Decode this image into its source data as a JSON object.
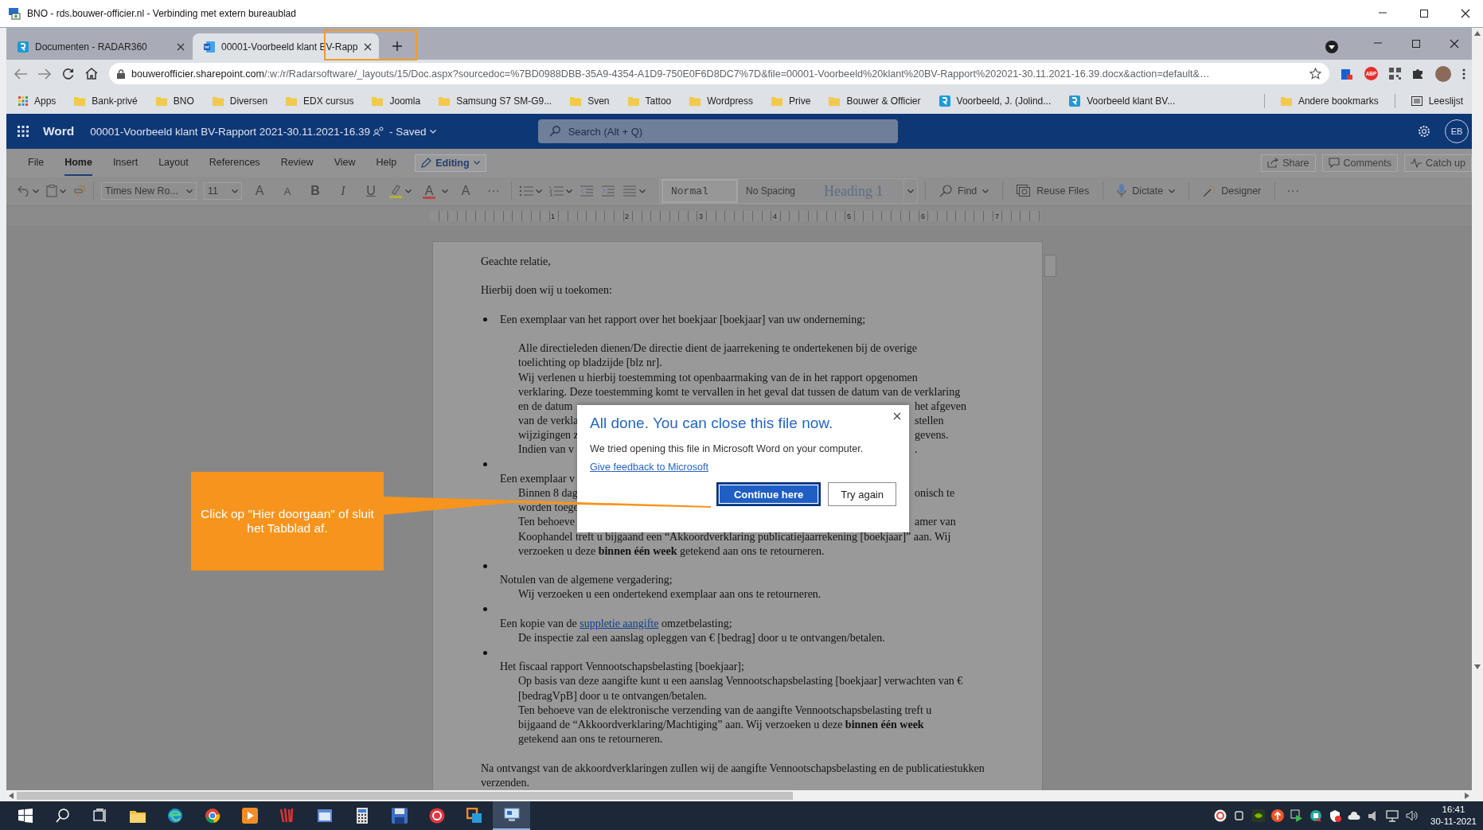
{
  "remote_window": {
    "title": "BNO - rds.bouwer-officier.nl - Verbinding met extern bureaublad"
  },
  "browser": {
    "tabs": [
      {
        "title": "Documenten - RADAR360",
        "kind": "site",
        "selected": false
      },
      {
        "title": "00001-Voorbeeld klant BV-Rapp",
        "kind": "document",
        "selected": true
      }
    ],
    "address": {
      "host": "bouwerofficier.sharepoint.com",
      "path": "/:w:/r/Radarsoftware/_layouts/15/Doc.aspx?sourcedoc=%7BD0988DBB-35A9-4354-A1D9-750E0F6D8DC7%7D&file=00001-Voorbeeld%20klant%20BV-Rapport%202021-30.11.2021-16.39.docx&action=default&…"
    },
    "extension_badge": "ABP",
    "bookmarks": [
      {
        "label": "Apps",
        "kind": "apps"
      },
      {
        "label": "Bank-privé",
        "kind": "folder"
      },
      {
        "label": "BNO",
        "kind": "folder"
      },
      {
        "label": "Diversen",
        "kind": "folder"
      },
      {
        "label": "EDX cursus",
        "kind": "folder"
      },
      {
        "label": "Joomla",
        "kind": "folder"
      },
      {
        "label": "Samsung S7 SM-G9...",
        "kind": "folder"
      },
      {
        "label": "Sven",
        "kind": "folder"
      },
      {
        "label": "Tattoo",
        "kind": "folder"
      },
      {
        "label": "Wordpress",
        "kind": "folder"
      },
      {
        "label": "Prive",
        "kind": "folder"
      },
      {
        "label": "Bouwer & Officier",
        "kind": "folder"
      },
      {
        "label": "Voorbeeld, J. (Jolind...",
        "kind": "site"
      },
      {
        "label": "Voorbeeld klant BV...",
        "kind": "site"
      }
    ],
    "bookmarks_right": [
      {
        "label": "Andere bookmarks",
        "kind": "folder"
      },
      {
        "label": "Leeslijst",
        "kind": "list"
      }
    ]
  },
  "word": {
    "app_name": "Word",
    "document_title": "00001-Voorbeeld klant BV-Rapport 2021-30.11.2021-16.39",
    "save_status": "- Saved",
    "search": {
      "placeholder": "Search (Alt + Q)"
    },
    "user_initials": "EB",
    "ribbon_tabs": [
      {
        "label": "File",
        "selected": false
      },
      {
        "label": "Home",
        "selected": true
      },
      {
        "label": "Insert",
        "selected": false
      },
      {
        "label": "Layout",
        "selected": false
      },
      {
        "label": "References",
        "selected": false
      },
      {
        "label": "Review",
        "selected": false
      },
      {
        "label": "View",
        "selected": false
      },
      {
        "label": "Help",
        "selected": false
      }
    ],
    "mode": "Editing",
    "actions": [
      {
        "kind": "share",
        "label": "Share"
      },
      {
        "kind": "comments",
        "label": "Comments"
      },
      {
        "kind": "catchup",
        "label": "Catch up"
      }
    ],
    "font_name": "Times New Ro...",
    "font_size": "11",
    "format": [
      {
        "kind": "grow",
        "text": "A"
      },
      {
        "kind": "shrink",
        "text": "A"
      },
      {
        "kind": "bold",
        "text": "B"
      },
      {
        "kind": "italic",
        "text": "I"
      },
      {
        "kind": "underline",
        "text": "U"
      },
      {
        "kind": "highlight"
      },
      {
        "kind": "fontcolor",
        "text": "A"
      },
      {
        "kind": "clear",
        "text": "A"
      },
      {
        "kind": "more",
        "text": "···"
      }
    ],
    "styles": [
      {
        "label": "Normal",
        "kind": "normal",
        "selected": true
      },
      {
        "label": "No Spacing",
        "kind": "nospacing",
        "selected": false
      },
      {
        "label": "Heading 1",
        "kind": "heading",
        "selected": false
      }
    ],
    "tools": [
      {
        "kind": "find",
        "label": "Find",
        "dropdown": true
      },
      {
        "kind": "reuse",
        "label": "Reuse Files",
        "dropdown": false
      },
      {
        "kind": "dictate",
        "label": "Dictate",
        "dropdown": true
      },
      {
        "kind": "designer",
        "label": "Designer",
        "dropdown": false
      }
    ],
    "more": "···",
    "ruler": [
      "1",
      "2",
      "3",
      "4",
      "5",
      "6",
      "7"
    ]
  },
  "document": {
    "lines": [
      {
        "kind": "para",
        "text": "Geachte relatie,"
      },
      {
        "kind": "gap"
      },
      {
        "kind": "para",
        "text": "Hierbij doen wij u toekomen:"
      },
      {
        "kind": "gap"
      },
      {
        "kind": "bullet",
        "text": "Een exemplaar van het rapport over het boekjaar [boekjaar] van uw onderneming;"
      },
      {
        "kind": "gap"
      },
      {
        "kind": "sub",
        "text": "Alle directieleden dienen/De directie dient de jaarrekening te ondertekenen bij de overige"
      },
      {
        "kind": "sub",
        "text": "toelichting op bladzijde [blz nr]."
      },
      {
        "kind": "sub",
        "text": "Wij verlenen u hierbij toestemming tot openbaarmaking van de in het rapport opgenomen"
      },
      {
        "kind": "sub",
        "text": "verklaring. Deze toestemming komt te vervallen in het geval dat tussen de datum van de verklaring"
      },
      {
        "kind": "split",
        "left": "en de datum",
        "right": "het afgeven"
      },
      {
        "kind": "split",
        "left": "van de verkla",
        "right": "stellen"
      },
      {
        "kind": "split",
        "left": "wijzigingen z",
        "right": "gevens."
      },
      {
        "kind": "split",
        "left": "Indien van v",
        "right": "."
      },
      {
        "kind": "dot"
      },
      {
        "kind": "item",
        "text": "Een exemplaar v"
      },
      {
        "kind": "split",
        "left": "Binnen 8 dag",
        "right": "onisch te"
      },
      {
        "kind": "sub",
        "text": "worden toege"
      },
      {
        "kind": "split",
        "left": "Ten behoeve",
        "right": "amer van"
      },
      {
        "kind": "sub",
        "text": "Koophandel treft u bijgaand een “Akkoordverklaring publicatiejaarrekening [boekjaar]” aan. Wij"
      },
      {
        "kind": "sub",
        "text": "verzoeken u deze **binnen één week** getekend aan ons te retourneren."
      },
      {
        "kind": "dot"
      },
      {
        "kind": "item",
        "text": "Notulen van de algemene vergadering;"
      },
      {
        "kind": "sub",
        "text": "Wij verzoeken u een ondertekend exemplaar aan ons te retourneren."
      },
      {
        "kind": "dot"
      },
      {
        "kind": "link_item",
        "text": "Een kopie van de ",
        "link": "suppletie aangifte",
        "after": " omzetbelasting;"
      },
      {
        "kind": "sub",
        "text": "De inspectie zal een aanslag opleggen van € [bedrag] door u te ontvangen/betalen."
      },
      {
        "kind": "dot"
      },
      {
        "kind": "item",
        "text": "Het fiscaal rapport Vennootschapsbelasting [boekjaar];"
      },
      {
        "kind": "sub",
        "text": "Op basis van deze aangifte kunt u een aanslag Vennootschapsbelasting [boekjaar] verwachten van €"
      },
      {
        "kind": "sub",
        "text": "[bedragVpB] door u te ontvangen/betalen."
      },
      {
        "kind": "sub",
        "text": "Ten behoeve van de elektronische verzending van de aangifte Vennootschapsbelasting treft u"
      },
      {
        "kind": "sub",
        "text": "bijgaand de “Akkoordverklaring/Machtiging” aan. Wij verzoeken u deze **binnen één week**"
      },
      {
        "kind": "sub",
        "text": "getekend aan ons te retourneren."
      },
      {
        "kind": "gap"
      },
      {
        "kind": "para",
        "text": "Na ontvangst van de akkoordverklaringen zullen wij de aangifte Vennootschapsbelasting en de publicatiestukken"
      },
      {
        "kind": "para",
        "text": "verzenden."
      }
    ]
  },
  "dialog": {
    "title": "All done. You can close this file now.",
    "message": "We tried opening this file in Microsoft Word on your computer.",
    "link": "Give feedback to Microsoft",
    "buttons": [
      {
        "label": "Continue here",
        "primary": true
      },
      {
        "label": "Try again",
        "primary": false
      }
    ]
  },
  "callout": {
    "text": "Click op \"Hier doorgaan\" of sluit het Tabblad af."
  },
  "taskbar": {
    "time": "16:41",
    "date": "30-11-2021"
  }
}
